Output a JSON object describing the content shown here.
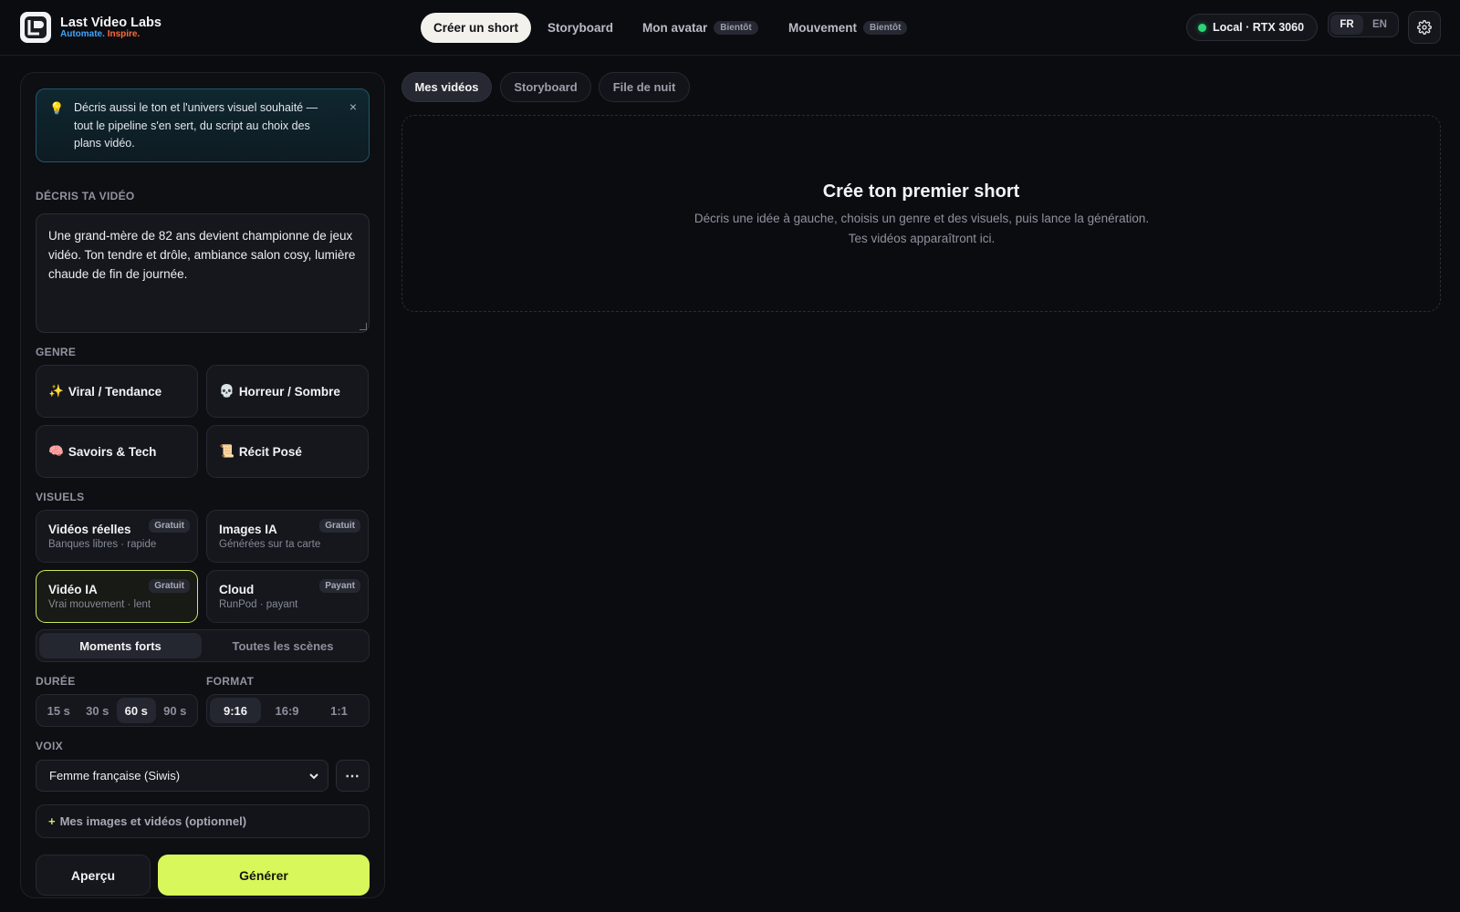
{
  "brand": {
    "name": "Last Video Labs",
    "tag_a": "Automate.",
    "tag_b": "Inspire.",
    "logo_icon": "lvl-logo-icon"
  },
  "nav": [
    {
      "label": "Créer un short",
      "active": true
    },
    {
      "label": "Storyboard"
    },
    {
      "label": "Mon avatar",
      "badge": "Bientôt"
    },
    {
      "label": "Mouvement",
      "badge": "Bientôt"
    }
  ],
  "gpu": {
    "label": "Local · RTX 3060",
    "status_color": "#2ed477"
  },
  "lang": {
    "fr": "FR",
    "en": "EN",
    "selected": "FR"
  },
  "settings_icon": "gear-icon",
  "tip": {
    "icon": "bulb-icon",
    "text": "Décris aussi le ton et l'univers visuel souhaité — tout le pipeline s'en sert, du script au choix des plans vidéo.",
    "close": "×"
  },
  "describe": {
    "label": "DÉCRIS TA VIDÉO",
    "value": "Une grand-mère de 82 ans devient championne de jeux vidéo. Ton tendre et drôle, ambiance salon cosy, lumière chaude de fin de journée."
  },
  "genre": {
    "label": "GENRE",
    "items": [
      {
        "emoji": "✨",
        "label": "Viral / Tendance"
      },
      {
        "emoji": "💀",
        "label": "Horreur / Sombre"
      },
      {
        "emoji": "🧠",
        "label": "Savoirs & Tech"
      },
      {
        "emoji": "📜",
        "label": "Récit Posé"
      }
    ]
  },
  "visuals": {
    "label": "VISUELS",
    "items": [
      {
        "title": "Vidéos réelles",
        "sub": "Banques libres · rapide",
        "badge": "Gratuit"
      },
      {
        "title": "Images IA",
        "sub": "Générées sur ta carte",
        "badge": "Gratuit"
      },
      {
        "title": "Vidéo IA",
        "sub": "Vrai mouvement · lent",
        "badge": "Gratuit",
        "selected": true
      },
      {
        "title": "Cloud",
        "sub": "RunPod · payant",
        "badge": "Payant"
      }
    ],
    "accent": "#c9ea5c"
  },
  "scenes": {
    "options": [
      "Moments forts",
      "Toutes les scènes"
    ],
    "selected": "Moments forts"
  },
  "duration": {
    "label": "DURÉE",
    "options": [
      "15 s",
      "30 s",
      "60 s",
      "90 s"
    ],
    "selected": "60 s"
  },
  "format": {
    "label": "FORMAT",
    "options": [
      "9:16",
      "16:9",
      "1:1"
    ],
    "selected": "9:16"
  },
  "voice": {
    "label": "VOIX",
    "value": "Femme française (Siwis)",
    "more": "⋯"
  },
  "media": {
    "plus": "+",
    "label": "Mes images et vidéos (optionnel)"
  },
  "actions": {
    "preview": "Aperçu",
    "generate": "Générer",
    "generate_color": "#d8f75a"
  },
  "right_tabs": [
    {
      "label": "Mes vidéos",
      "active": true
    },
    {
      "label": "Storyboard"
    },
    {
      "label": "File de nuit"
    }
  ],
  "empty": {
    "title": "Crée ton premier short",
    "desc": "Décris une idée à gauche, choisis un genre et des visuels, puis lance la génération. Tes vidéos apparaîtront ici."
  }
}
